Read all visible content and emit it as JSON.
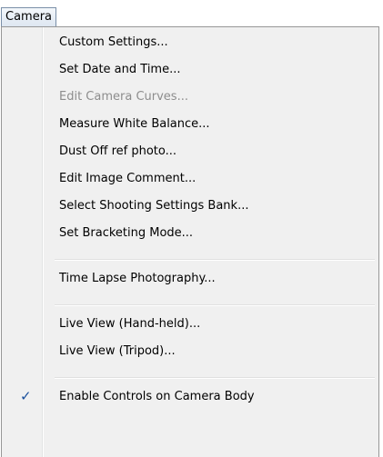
{
  "menubar": {
    "tab_label": "Camera"
  },
  "menu": {
    "items": [
      {
        "label": "Custom Settings...",
        "enabled": true
      },
      {
        "label": "Set Date and Time...",
        "enabled": true
      },
      {
        "label": "Edit Camera Curves...",
        "enabled": false
      },
      {
        "label": "Measure White Balance...",
        "enabled": true
      },
      {
        "label": "Dust Off ref photo...",
        "enabled": true
      },
      {
        "label": "Edit Image Comment...",
        "enabled": true
      },
      {
        "label": "Select Shooting Settings Bank...",
        "enabled": true
      },
      {
        "label": "Set Bracketing Mode...",
        "enabled": true
      },
      {
        "label": "Time Lapse Photography...",
        "enabled": true
      },
      {
        "label": "Live View (Hand-held)...",
        "enabled": true
      },
      {
        "label": "Live View (Tripod)...",
        "enabled": true
      },
      {
        "label": "Enable Controls on Camera Body",
        "enabled": true,
        "checked": true,
        "check_glyph": "✓"
      }
    ]
  }
}
